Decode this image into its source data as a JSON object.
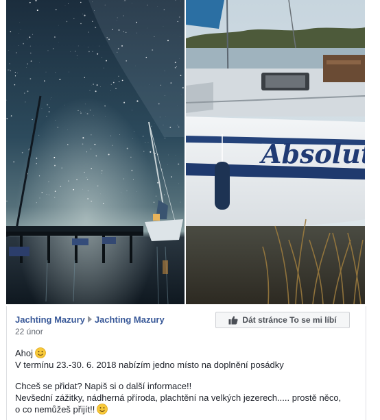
{
  "photos": {
    "left_alt": "night-sky-sailboats",
    "right_alt": "boat-absolut",
    "boat_name": "Absolut"
  },
  "post": {
    "author": "Jachting Mazury",
    "target": "Jachting Mazury",
    "date": "22 únor",
    "like_button": "Dát stránce To se mi líbí",
    "lines": {
      "line1": "Ahoj",
      "line2": "V termínu 23.-30. 6. 2018 nabízím jedno místo na doplnění posádky",
      "line3": "Chceš se přidat? Napiš si o další informace!!",
      "line4": "Nevšední zážitky, nádherná příroda, plachtění na velkých jezerech..... prostě něco,",
      "line5": "o co nemůžeš přijít!!"
    }
  },
  "icons": {
    "thumb": "thumbs-up-icon",
    "emoji": "smile-emoji-icon",
    "arrow": "arrow-right-icon"
  },
  "colors": {
    "link": "#385898",
    "sky": "#1f3b50",
    "water": "#14212b"
  }
}
